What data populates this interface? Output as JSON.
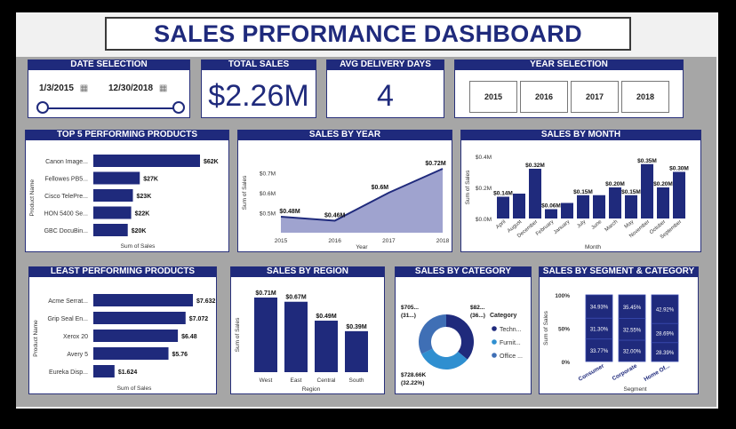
{
  "dashboard": {
    "title": "SALES PRFORMANCE DASHBOARD"
  },
  "colors": {
    "navy": "#1f2a7c",
    "light_blue": "#2f8fd0",
    "area": "#9fa3cf"
  },
  "date_selection": {
    "title": "DATE SELECTION",
    "start": "1/3/2015",
    "end": "12/30/2018",
    "calendar_icon": "calendar-icon"
  },
  "total_sales": {
    "title": "TOTAL SALES",
    "value": "$2.26M"
  },
  "avg_delivery": {
    "title": "AVG DELIVERY DAYS",
    "value": "4"
  },
  "year_selection": {
    "title": "YEAR SELECTION",
    "years": [
      "2015",
      "2016",
      "2017",
      "2018"
    ]
  },
  "chart_data": [
    {
      "id": "top5",
      "type": "bar",
      "orientation": "horizontal",
      "title": "TOP 5 PERFORMING PRODUCTS",
      "xlabel": "Sum of Sales",
      "ylabel": "Product Name",
      "categories": [
        "Canon Image...",
        "Fellowes PB5...",
        "Cisco TelePre...",
        "HON 5400 Se...",
        "GBC DocuBin..."
      ],
      "values": [
        62,
        27,
        23,
        22,
        20
      ],
      "labels": [
        "$62K",
        "$27K",
        "$23K",
        "$22K",
        "$20K"
      ]
    },
    {
      "id": "by_year",
      "type": "area",
      "title": "SALES BY YEAR",
      "xlabel": "Year",
      "ylabel": "Sum of Sales",
      "x": [
        "2015",
        "2016",
        "2017",
        "2018"
      ],
      "values": [
        0.48,
        0.46,
        0.6,
        0.72
      ],
      "labels": [
        "$0.48M",
        "$0.46M",
        "$0.6M",
        "$0.72M"
      ],
      "y_ticks": [
        "$0.5M",
        "$0.6M",
        "$0.7M"
      ],
      "ylim": [
        0.4,
        0.8
      ]
    },
    {
      "id": "by_month",
      "type": "bar",
      "title": "SALES BY MONTH",
      "xlabel": "Month",
      "ylabel": "Sum of Sales",
      "categories": [
        "April",
        "August",
        "December",
        "February",
        "January",
        "July",
        "June",
        "March",
        "May",
        "November",
        "October",
        "September"
      ],
      "values": [
        0.14,
        0.16,
        0.32,
        0.06,
        0.1,
        0.15,
        0.15,
        0.2,
        0.15,
        0.35,
        0.2,
        0.3
      ],
      "labels": [
        "$0.14M",
        "",
        "$0.32M",
        "$0.06M",
        "",
        "$0.15M",
        "",
        "$0.20M",
        "$0.15M",
        "$0.35M",
        "$0.20M",
        "$0.30M"
      ],
      "y_ticks": [
        "$0.0M",
        "$0.2M",
        "$0.4M"
      ],
      "ylim": [
        0,
        0.4
      ]
    },
    {
      "id": "least",
      "type": "bar",
      "orientation": "horizontal",
      "title": "LEAST PERFORMING PRODUCTS",
      "xlabel": "Sum of Sales",
      "ylabel": "Product Name",
      "categories": [
        "Acme Serrat...",
        "Grip Seal En...",
        "Xerox 20",
        "Avery 5",
        "Eureka Disp..."
      ],
      "values": [
        7.632,
        7.072,
        6.48,
        5.76,
        1.624
      ],
      "labels": [
        "$7.632",
        "$7.072",
        "$6.48",
        "$5.76",
        "$1.624"
      ]
    },
    {
      "id": "by_region",
      "type": "bar",
      "title": "SALES BY REGION",
      "xlabel": "Region",
      "ylabel": "Sum of Sales",
      "categories": [
        "West",
        "East",
        "Central",
        "South"
      ],
      "values": [
        0.71,
        0.67,
        0.49,
        0.39
      ],
      "labels": [
        "$0.71M",
        "$0.67M",
        "$0.49M",
        "$0.39M"
      ]
    },
    {
      "id": "by_category",
      "type": "pie",
      "title": "SALES BY CATEGORY",
      "legend_title": "Category",
      "categories": [
        "Techn...",
        "Furnit...",
        "Office ..."
      ],
      "values": [
        36,
        31.78,
        32.22
      ],
      "slice_colors": [
        "#1f2a7c",
        "#2f8fd0",
        "#3f6fb5"
      ],
      "labels": [
        "$82...",
        "(36...)",
        "$705...",
        "(31...)",
        "$728.66K",
        "(32.22%)"
      ]
    },
    {
      "id": "by_segment",
      "type": "bar",
      "stacked": "100%",
      "title": "SALES BY SEGMENT & CATEGORY",
      "xlabel": "Segment",
      "ylabel": "Sum of Sales",
      "categories": [
        "Consumer",
        "Corporate",
        "Home Of..."
      ],
      "series": [
        {
          "values": [
            33.77,
            32.0,
            28.39
          ],
          "labels": [
            "33.77%",
            "32.00%",
            "28.39%"
          ]
        },
        {
          "values": [
            31.3,
            32.55,
            28.69
          ],
          "labels": [
            "31.30%",
            "32.55%",
            "28.69%"
          ]
        },
        {
          "values": [
            34.93,
            35.45,
            42.92
          ],
          "labels": [
            "34.93%",
            "35.45%",
            "42.92%"
          ]
        }
      ],
      "y_ticks": [
        "0%",
        "50%",
        "100%"
      ]
    }
  ]
}
